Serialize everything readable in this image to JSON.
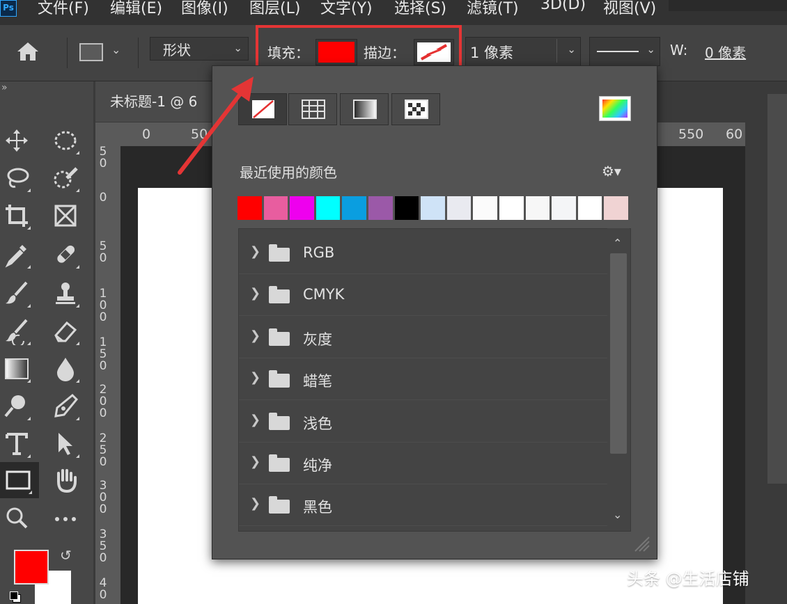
{
  "app": {
    "logo_text": "Ps"
  },
  "menu": [
    "文件(F)",
    "编辑(E)",
    "图像(I)",
    "图层(L)",
    "文字(Y)",
    "选择(S)",
    "滤镜(T)",
    "3D(D)",
    "视图(V)"
  ],
  "options_bar": {
    "shape_mode": "形状",
    "fill_label": "填充：",
    "fill_color": "#ff0000",
    "stroke_label": "描边：",
    "stroke_color": "none",
    "stroke_width": "1 像素",
    "width_label": "W:",
    "width_value": "0 像素"
  },
  "document": {
    "tab_label": "未标题-1 @ 6",
    "ruler_top_labels": [
      "0",
      "50",
      "550",
      "60"
    ],
    "ruler_left_labels": [
      [
        "5",
        "0"
      ],
      [
        "0"
      ],
      [
        "5",
        "0"
      ],
      [
        "1",
        "0",
        "0"
      ],
      [
        "1",
        "5",
        "0"
      ],
      [
        "2",
        "0",
        "0"
      ],
      [
        "2",
        "5",
        "0"
      ],
      [
        "3",
        "0",
        "0"
      ],
      [
        "3",
        "5",
        "0"
      ],
      [
        "4",
        "0"
      ]
    ]
  },
  "color_popup": {
    "type_buttons": [
      "none",
      "solid",
      "gradient",
      "pattern"
    ],
    "selected_type": "none",
    "recent_title": "最近使用的颜色",
    "recent_colors": [
      "#ff0000",
      "#e85d9f",
      "#ee00ee",
      "#00ffff",
      "#0a9ee0",
      "#9b59a8",
      "#000000",
      "#cfe3f7",
      "#e9eaf0",
      "#fbfbfb",
      "#ffffff",
      "#f7f7f7",
      "#f4f5f7",
      "#ffffff",
      "#f0d3d3"
    ],
    "folders": [
      "RGB",
      "CMYK",
      "灰度",
      "蜡笔",
      "浅色",
      "纯净",
      "黑色"
    ]
  },
  "tools": {
    "foreground_color": "#ff0000",
    "background_color": "#ffffff"
  },
  "watermark": "头条 @生活店铺"
}
